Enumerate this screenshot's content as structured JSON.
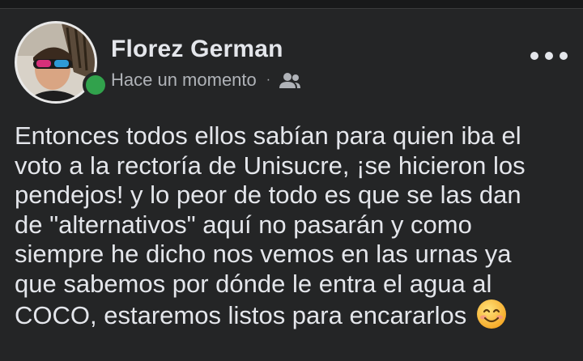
{
  "post": {
    "author": "Florez German",
    "timestamp": "Hace un momento",
    "separator": "·",
    "audience_icon": "friends-icon",
    "menu_icon": "more-options-icon",
    "text": "Entonces todos ellos sabían para quien iba el\nvoto a la rectoría de Unisucre, ¡se hicieron los\npendejos! y lo peor de todo es que se las dan\nde \"alternativos\" aquí no pasarán y como\nsiempre he dicho nos vemos en las urnas ya\nque sabemos por dónde le entra el agua al\nCOCO, estaremos listos para encararlos",
    "emoji": "smiling-face-emoji"
  },
  "colors": {
    "background": "#242526",
    "text_primary": "#e4e6eb",
    "text_secondary": "#b0b3b8",
    "online": "#31a24c"
  }
}
